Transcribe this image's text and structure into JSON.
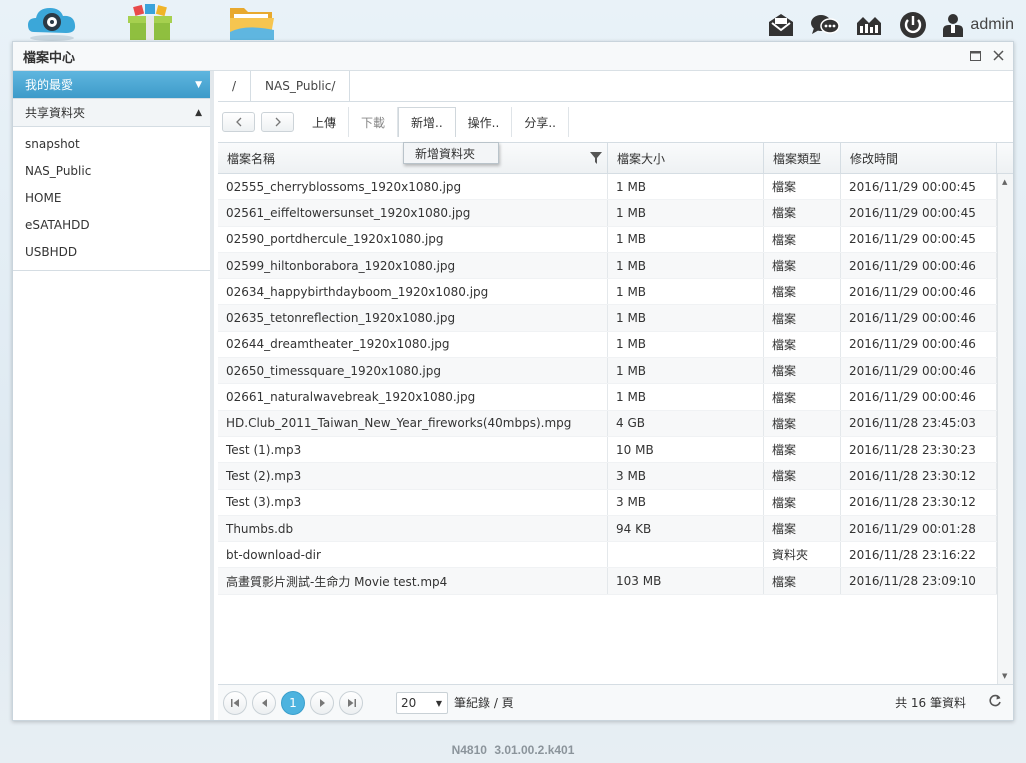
{
  "desktop": {
    "icons": [
      "cloud-backup-icon",
      "app-center-icon",
      "file-center-icon"
    ]
  },
  "topbar": {
    "user": "admin",
    "icons": [
      "message-icon",
      "chat-icon",
      "monitor-icon",
      "power-icon",
      "user-icon"
    ]
  },
  "window": {
    "title": "檔案中心"
  },
  "sidebar": {
    "favorites_label": "我的最愛",
    "shared_label": "共享資料夾",
    "items": [
      "snapshot",
      "NAS_Public",
      "HOME",
      "eSATAHDD",
      "USBHDD"
    ]
  },
  "breadcrumb": {
    "root": "/",
    "current": "NAS_Public/"
  },
  "toolbar": {
    "upload": "上傳",
    "download": "下載",
    "add": "新增..",
    "operate": "操作..",
    "share": "分享..",
    "add_menu_item": "新增資料夾"
  },
  "grid": {
    "headers": {
      "name": "檔案名稱",
      "size": "檔案大小",
      "type": "檔案類型",
      "modified": "修改時間"
    },
    "rows": [
      {
        "name": "02555_cherryblossoms_1920x1080.jpg",
        "size": "1 MB",
        "type": "檔案",
        "modified": "2016/11/29 00:00:45"
      },
      {
        "name": "02561_eiffeltowersunset_1920x1080.jpg",
        "size": "1 MB",
        "type": "檔案",
        "modified": "2016/11/29 00:00:45"
      },
      {
        "name": "02590_portdhercule_1920x1080.jpg",
        "size": "1 MB",
        "type": "檔案",
        "modified": "2016/11/29 00:00:45"
      },
      {
        "name": "02599_hiltonborabora_1920x1080.jpg",
        "size": "1 MB",
        "type": "檔案",
        "modified": "2016/11/29 00:00:46"
      },
      {
        "name": "02634_happybirthdayboom_1920x1080.jpg",
        "size": "1 MB",
        "type": "檔案",
        "modified": "2016/11/29 00:00:46"
      },
      {
        "name": "02635_tetonreflection_1920x1080.jpg",
        "size": "1 MB",
        "type": "檔案",
        "modified": "2016/11/29 00:00:46"
      },
      {
        "name": "02644_dreamtheater_1920x1080.jpg",
        "size": "1 MB",
        "type": "檔案",
        "modified": "2016/11/29 00:00:46"
      },
      {
        "name": "02650_timessquare_1920x1080.jpg",
        "size": "1 MB",
        "type": "檔案",
        "modified": "2016/11/29 00:00:46"
      },
      {
        "name": "02661_naturalwavebreak_1920x1080.jpg",
        "size": "1 MB",
        "type": "檔案",
        "modified": "2016/11/29 00:00:46"
      },
      {
        "name": "HD.Club_2011_Taiwan_New_Year_fireworks(40mbps).mpg",
        "size": "4 GB",
        "type": "檔案",
        "modified": "2016/11/28 23:45:03"
      },
      {
        "name": "Test (1).mp3",
        "size": "10 MB",
        "type": "檔案",
        "modified": "2016/11/28 23:30:23"
      },
      {
        "name": "Test (2).mp3",
        "size": "3 MB",
        "type": "檔案",
        "modified": "2016/11/28 23:30:12"
      },
      {
        "name": "Test (3).mp3",
        "size": "3 MB",
        "type": "檔案",
        "modified": "2016/11/28 23:30:12"
      },
      {
        "name": "Thumbs.db",
        "size": "94 KB",
        "type": "檔案",
        "modified": "2016/11/29 00:01:28"
      },
      {
        "name": "bt-download-dir",
        "size": "",
        "type": "資料夾",
        "modified": "2016/11/28 23:16:22"
      },
      {
        "name": "高畫質影片測試-生命力 Movie test.mp4",
        "size": "103 MB",
        "type": "檔案",
        "modified": "2016/11/28 23:09:10"
      }
    ]
  },
  "pager": {
    "current_page": "1",
    "page_size": "20",
    "unit": "筆紀錄 / 頁",
    "total": "共 16 筆資料"
  },
  "footer": {
    "model": "N4810",
    "version": "3.01.00.2.k401"
  },
  "colors": {
    "accent": "#4db3df",
    "sidebar_active": "#3d9bc9"
  }
}
